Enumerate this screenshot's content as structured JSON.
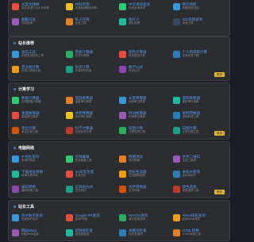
{
  "colors": {
    "accent": "#3b7bd8",
    "more_button": "#e0b52c",
    "tool_title": "#5a9cf0"
  },
  "sections": [
    {
      "title": "",
      "tools": [
        {
          "title": "大案文转换",
          "desc": "将文本进行大小写转换",
          "icon": "#e74c3c"
        },
        {
          "title": "材料检测",
          "desc": "在线检测网页材料",
          "icon": "#f1c40f"
        },
        {
          "title": "中华诗词查询",
          "desc": "在线查询诗词",
          "icon": "#2ecc71"
        },
        {
          "title": "网页抓取",
          "desc": "抓取网页内容",
          "icon": "#3498db"
        },
        {
          "title": "翻翻与查",
          "desc": "在线查询",
          "icon": "#9b59b6"
        },
        {
          "title": "私人在线",
          "desc": "在线工具",
          "icon": "#e67e22"
        },
        {
          "title": "图片小",
          "desc": "图片处理",
          "icon": "#1abc9c"
        },
        {
          "title": "ISO等级查询",
          "desc": "查询工具",
          "icon": "#34495e"
        }
      ],
      "more": ""
    },
    {
      "title": "站长推荐",
      "tools": [
        {
          "title": "短信工具",
          "desc": "在线发送短信工具",
          "icon": "#3498db"
        },
        {
          "title": "简易计算器",
          "desc": "在线计算器",
          "icon": "#27ae60"
        },
        {
          "title": "配色计算器",
          "desc": "网页配色计算",
          "icon": "#e74c3c"
        },
        {
          "title": "个人所得税计算",
          "desc": "在线计算个税",
          "icon": "#2980b9"
        },
        {
          "title": "营业税计算",
          "desc": "在线计算营业税",
          "icon": "#f39c12"
        },
        {
          "title": "房贷计算",
          "desc": "计算房贷利息",
          "icon": "#16a085"
        },
        {
          "title": "数学公式",
          "desc": "在线公式",
          "icon": "#8e44ad"
        },
        {
          "title": "",
          "desc": "",
          "icon": ""
        }
      ],
      "more": "更多"
    },
    {
      "title": "计算学习",
      "tools": [
        {
          "title": "数据计算器",
          "desc": "在线数据计算器",
          "icon": "#2ecc71"
        },
        {
          "title": "温度换算器",
          "desc": "温度单位换算",
          "icon": "#e67e22"
        },
        {
          "title": "长度换算器",
          "desc": "长度单位换算",
          "icon": "#3498db"
        },
        {
          "title": "面积换算器",
          "desc": "面积单位换算",
          "icon": "#1abc9c"
        },
        {
          "title": "重量换算器",
          "desc": "重量单位换算",
          "icon": "#e74c3c"
        },
        {
          "title": "体积换算器",
          "desc": "体积单位换算",
          "icon": "#f1c40f"
        },
        {
          "title": "时间换算器",
          "desc": "时间单位换算",
          "icon": "#9b59b6"
        },
        {
          "title": "进制转换器",
          "desc": "进制转换工具",
          "icon": "#2980b9"
        },
        {
          "title": "单位计算",
          "desc": "单位计算工具",
          "icon": "#d35400"
        },
        {
          "title": "科学计算器",
          "desc": "在线科学计算",
          "icon": "#c0392b"
        },
        {
          "title": "成绩计算",
          "desc": "计算成绩工具",
          "icon": "#27ae60"
        },
        {
          "title": "日期计算",
          "desc": "计算日期工具",
          "icon": "#16a085"
        }
      ],
      "more": "更多"
    },
    {
      "title": "电脑网络",
      "tools": [
        {
          "title": "IP地址查询",
          "desc": "查询IP地址",
          "icon": "#3498db"
        },
        {
          "title": "在线编辑",
          "desc": "在线编辑工具",
          "icon": "#2ecc71"
        },
        {
          "title": "网速测试",
          "desc": "测试网速",
          "icon": "#e67e22"
        },
        {
          "title": "文件二维码",
          "desc": "生成二维码",
          "icon": "#9b59b6"
        },
        {
          "title": "下载地址转换",
          "desc": "转换下载地址",
          "icon": "#1abc9c"
        },
        {
          "title": "IIS日志生成",
          "desc": "生成日志",
          "icon": "#e74c3c"
        },
        {
          "title": "密码生成器",
          "desc": "生成随机密码",
          "icon": "#f39c12"
        },
        {
          "title": "本机IP查询",
          "desc": "查询本机IP",
          "icon": "#2980b9"
        },
        {
          "title": "编码转换",
          "desc": "编码转换工具",
          "icon": "#8e44ad"
        },
        {
          "title": "正则表达式",
          "desc": "正则测试",
          "icon": "#16a085"
        },
        {
          "title": "文字转换器",
          "desc": "文字转换",
          "icon": "#d35400"
        },
        {
          "title": "颜色选择",
          "desc": "颜色选择工具",
          "icon": "#c0392b"
        }
      ],
      "more": "更多"
    },
    {
      "title": "站长工具",
      "tools": [
        {
          "title": "同IP站点查询",
          "desc": "查询同IP站点",
          "icon": "#3498db"
        },
        {
          "title": "Google PR查询",
          "desc": "查询PR值",
          "icon": "#e74c3c"
        },
        {
          "title": "WHOIS查询",
          "desc": "域名信息查询",
          "icon": "#27ae60"
        },
        {
          "title": "Alexa排名查询",
          "desc": "查询Alexa排名",
          "icon": "#f39c12"
        },
        {
          "title": "网站Meta",
          "desc": "网站Meta信息",
          "icon": "#9b59b6"
        },
        {
          "title": "超链接检查",
          "desc": "检查超链接",
          "icon": "#1abc9c"
        },
        {
          "title": "关键词检查",
          "desc": "检查关键词",
          "icon": "#2980b9"
        },
        {
          "title": "HTML转换",
          "desc": "HTML转换工具",
          "icon": "#e67e22"
        }
      ],
      "more": "更多"
    }
  ]
}
